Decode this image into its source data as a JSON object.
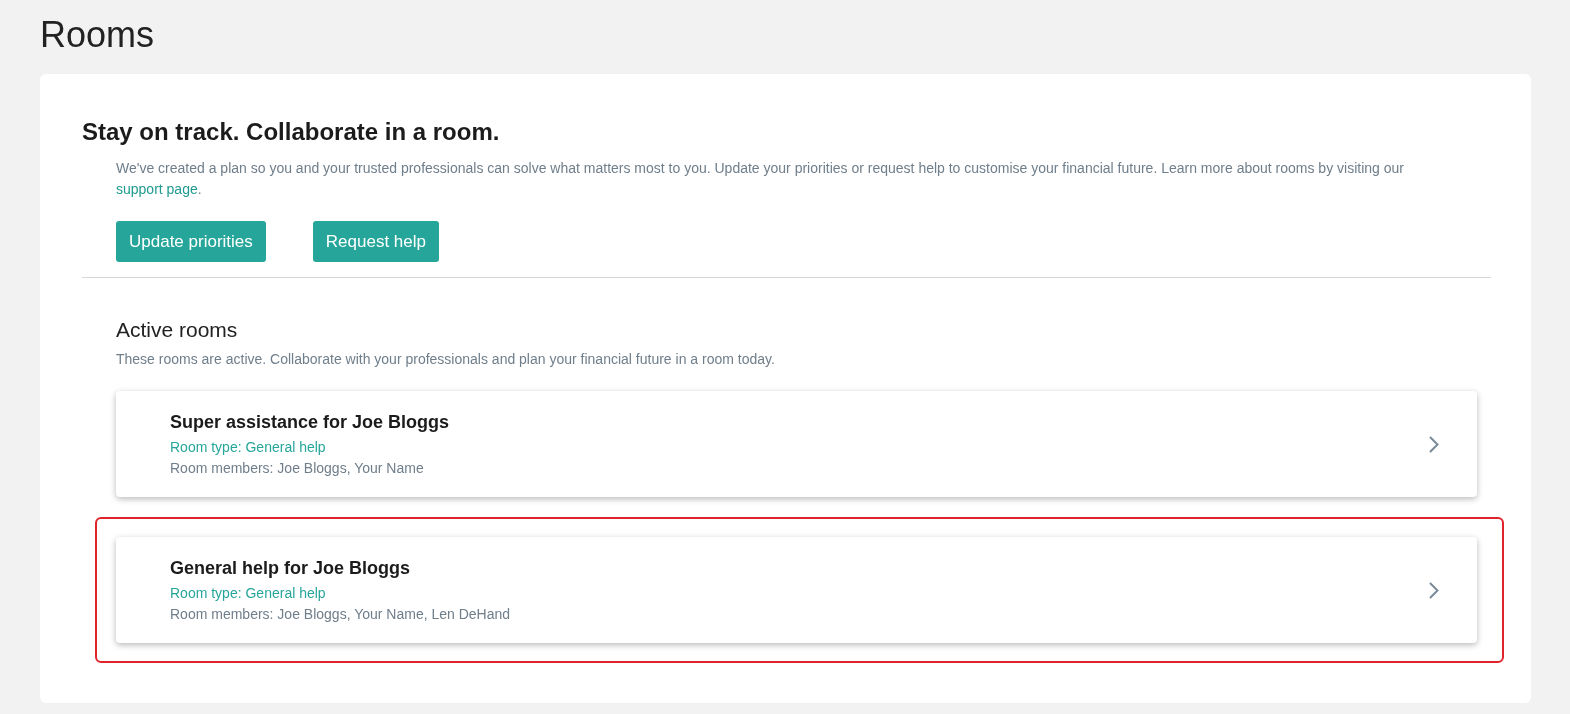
{
  "page_title": "Rooms",
  "intro": {
    "heading": "Stay on track. Collaborate in a room.",
    "text": "We've created a plan so you and your trusted professionals can solve what matters most to you. Update your priorities or request help to customise your financial future. Learn more about rooms by visiting our ",
    "link": "support page",
    "text_end": ".",
    "buttons": [
      "Update priorities",
      "Request help"
    ]
  },
  "active_rooms": {
    "heading": "Active rooms",
    "subtext": "These rooms are active. Collaborate with your professionals and plan your financial future in a room today.",
    "rooms": [
      {
        "name": "Super assistance for Joe Bloggs",
        "type": "Room type: General help",
        "members": "Room members: Joe Bloggs, Your Name",
        "highlighted": false
      },
      {
        "name": "General help for Joe Bloggs",
        "type": "Room type: General help",
        "members": "Room members: Joe Bloggs, Your Name, Len DeHand",
        "highlighted": true
      }
    ]
  }
}
